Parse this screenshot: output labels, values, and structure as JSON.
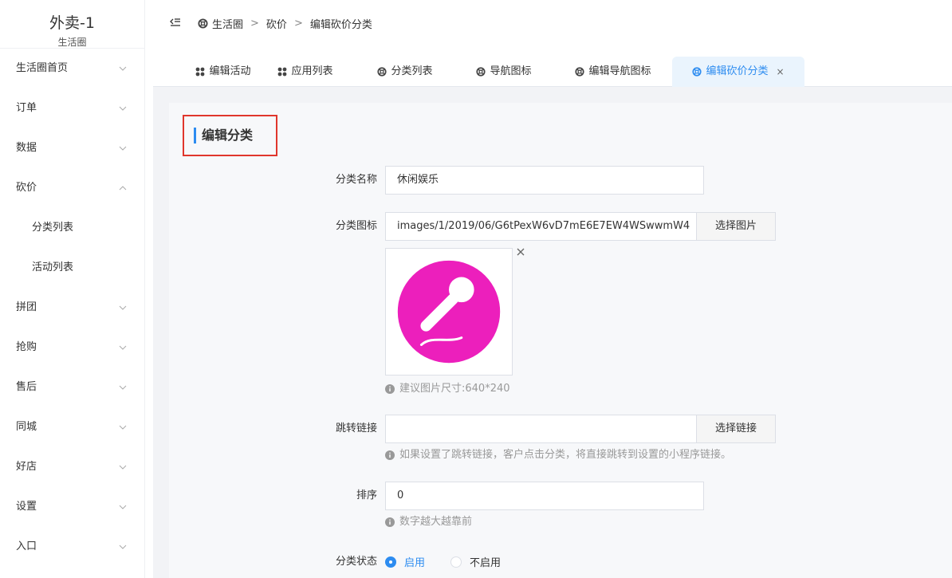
{
  "brand": {
    "title": "外卖-1",
    "subtitle": "生活圈"
  },
  "sidebar": {
    "items": [
      {
        "label": "生活圈首页",
        "chevron": "down"
      },
      {
        "label": "订单",
        "chevron": "down"
      },
      {
        "label": "数据",
        "chevron": "down"
      },
      {
        "label": "砍价",
        "chevron": "up"
      },
      {
        "label": "分类列表"
      },
      {
        "label": "活动列表"
      },
      {
        "label": "拼团",
        "chevron": "down"
      },
      {
        "label": "抢购",
        "chevron": "down"
      },
      {
        "label": "售后",
        "chevron": "down"
      },
      {
        "label": "同城",
        "chevron": "down"
      },
      {
        "label": "好店",
        "chevron": "down"
      },
      {
        "label": "设置",
        "chevron": "down"
      },
      {
        "label": "入口",
        "chevron": "down"
      }
    ]
  },
  "breadcrumb": {
    "items": [
      "生活圈",
      "砍价",
      "编辑砍价分类"
    ],
    "separator": ">"
  },
  "tabs": [
    {
      "label": "编辑活动",
      "icon": "grid-icon"
    },
    {
      "label": "应用列表",
      "icon": "grid-icon"
    },
    {
      "label": "分类列表",
      "icon": "lifebuoy-icon"
    },
    {
      "label": "导航图标",
      "icon": "lifebuoy-icon"
    },
    {
      "label": "编辑导航图标",
      "icon": "lifebuoy-icon"
    },
    {
      "label": "编辑砍价分类",
      "icon": "lifebuoy-icon",
      "active": true,
      "close": "×"
    }
  ],
  "form": {
    "section_title": "编辑分类",
    "name": {
      "label": "分类名称",
      "value": "休闲娱乐"
    },
    "icon": {
      "label": "分类图标",
      "value": "images/1/2019/06/G6tPexW6vD7mE6E7EW4WSwwmW4",
      "button": "选择图片",
      "hint": "建议图片尺寸:640*240"
    },
    "link": {
      "label": "跳转链接",
      "value": "",
      "button": "选择链接",
      "hint": "如果设置了跳转链接，客户点击分类，将直接跳转到设置的小程序链接。"
    },
    "sort": {
      "label": "排序",
      "value": "0",
      "hint": "数字越大越靠前"
    },
    "status": {
      "label": "分类状态",
      "options": [
        "启用",
        "不启用"
      ],
      "selected": "启用"
    }
  },
  "colors": {
    "accent": "#2d8cf0",
    "highlight": "#e0362c",
    "mic_circle": "#ec1fbc"
  }
}
